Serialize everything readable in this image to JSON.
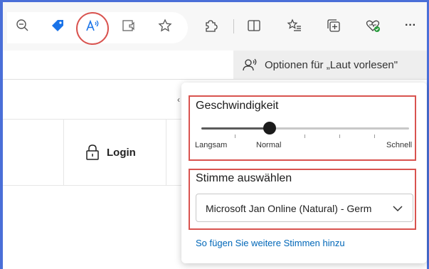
{
  "colors": {
    "frame": "#4a6fd8",
    "highlight": "#d9534f",
    "link": "#0067b8",
    "tag_icon": "#1a73e8",
    "read_aloud_icon": "#1a73e8",
    "health_badge": "#2a9d3f"
  },
  "toolbar": {
    "icons": [
      "zoom-out-icon",
      "coupon-tag-icon",
      "read-aloud-icon",
      "immersive-reader-icon",
      "favorite-star-icon",
      "extensions-puzzle-icon",
      "split-screen-icon",
      "favorites-list-icon",
      "collections-icon",
      "browser-essentials-icon",
      "more-menu-icon"
    ],
    "more_label": "···"
  },
  "read_aloud_bar": {
    "options_label": "Optionen für „Laut vorlesen\""
  },
  "page": {
    "login_label": "Login"
  },
  "panel": {
    "speed_title": "Geschwindigkeit",
    "speed_value": 0.33,
    "speed_labels": {
      "slow": "Langsam",
      "normal": "Normal",
      "fast": "Schnell"
    },
    "voice_title": "Stimme auswählen",
    "voice_selected": "Microsoft Jan Online (Natural) - Germ",
    "add_voices_link": "So fügen Sie weitere Stimmen hinzu"
  }
}
